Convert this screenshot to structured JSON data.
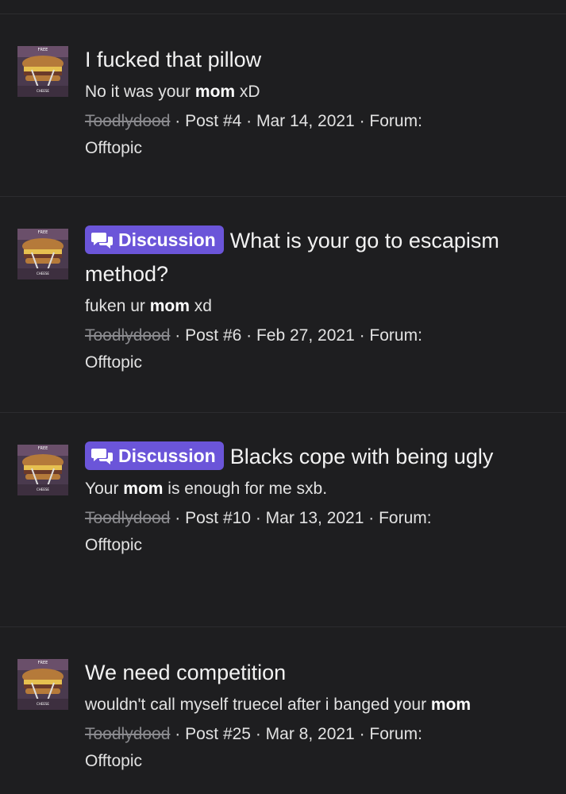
{
  "results": [
    {
      "badge": "",
      "title": "I fucked that pillow",
      "snippet": {
        "pre": "No it was your ",
        "highlight": "mom",
        "post": " xD"
      },
      "author": "Toodlydood",
      "post": "Post #4",
      "date": "Mar 14, 2021",
      "forum_label": "Forum:",
      "forum": "Offtopic"
    },
    {
      "badge": "Discussion",
      "title": "What is your go to escapism method?",
      "snippet": {
        "pre": "fuken ur ",
        "highlight": "mom",
        "post": " xd"
      },
      "author": "Toodlydood",
      "post": "Post #6",
      "date": "Feb 27, 2021",
      "forum_label": "Forum:",
      "forum": "Offtopic"
    },
    {
      "badge": "Discussion",
      "title": "Blacks cope with being ugly",
      "snippet": {
        "pre": "Your ",
        "highlight": "mom",
        "post": " is enough for me sxb."
      },
      "author": "Toodlydood",
      "post": "Post #10",
      "date": "Mar 13, 2021",
      "forum_label": "Forum:",
      "forum": "Offtopic"
    },
    {
      "badge": "",
      "title": "We need competition",
      "snippet": {
        "pre": "wouldn't call myself truecel after i banged your ",
        "highlight": "mom",
        "post": ""
      },
      "author": "Toodlydood",
      "post": "Post #25",
      "date": "Mar 8, 2021",
      "forum_label": "Forum:",
      "forum": "Offtopic"
    }
  ],
  "avatar": {
    "top_text": "FREE",
    "bottom_text": "CHEESE",
    "icon": "cheeseburger-avatar"
  },
  "badge_icon": "chat-bubbles-icon",
  "colors": {
    "background": "#1e1e20",
    "badge": "#6b55d9",
    "muted": "#8a8a8e"
  }
}
